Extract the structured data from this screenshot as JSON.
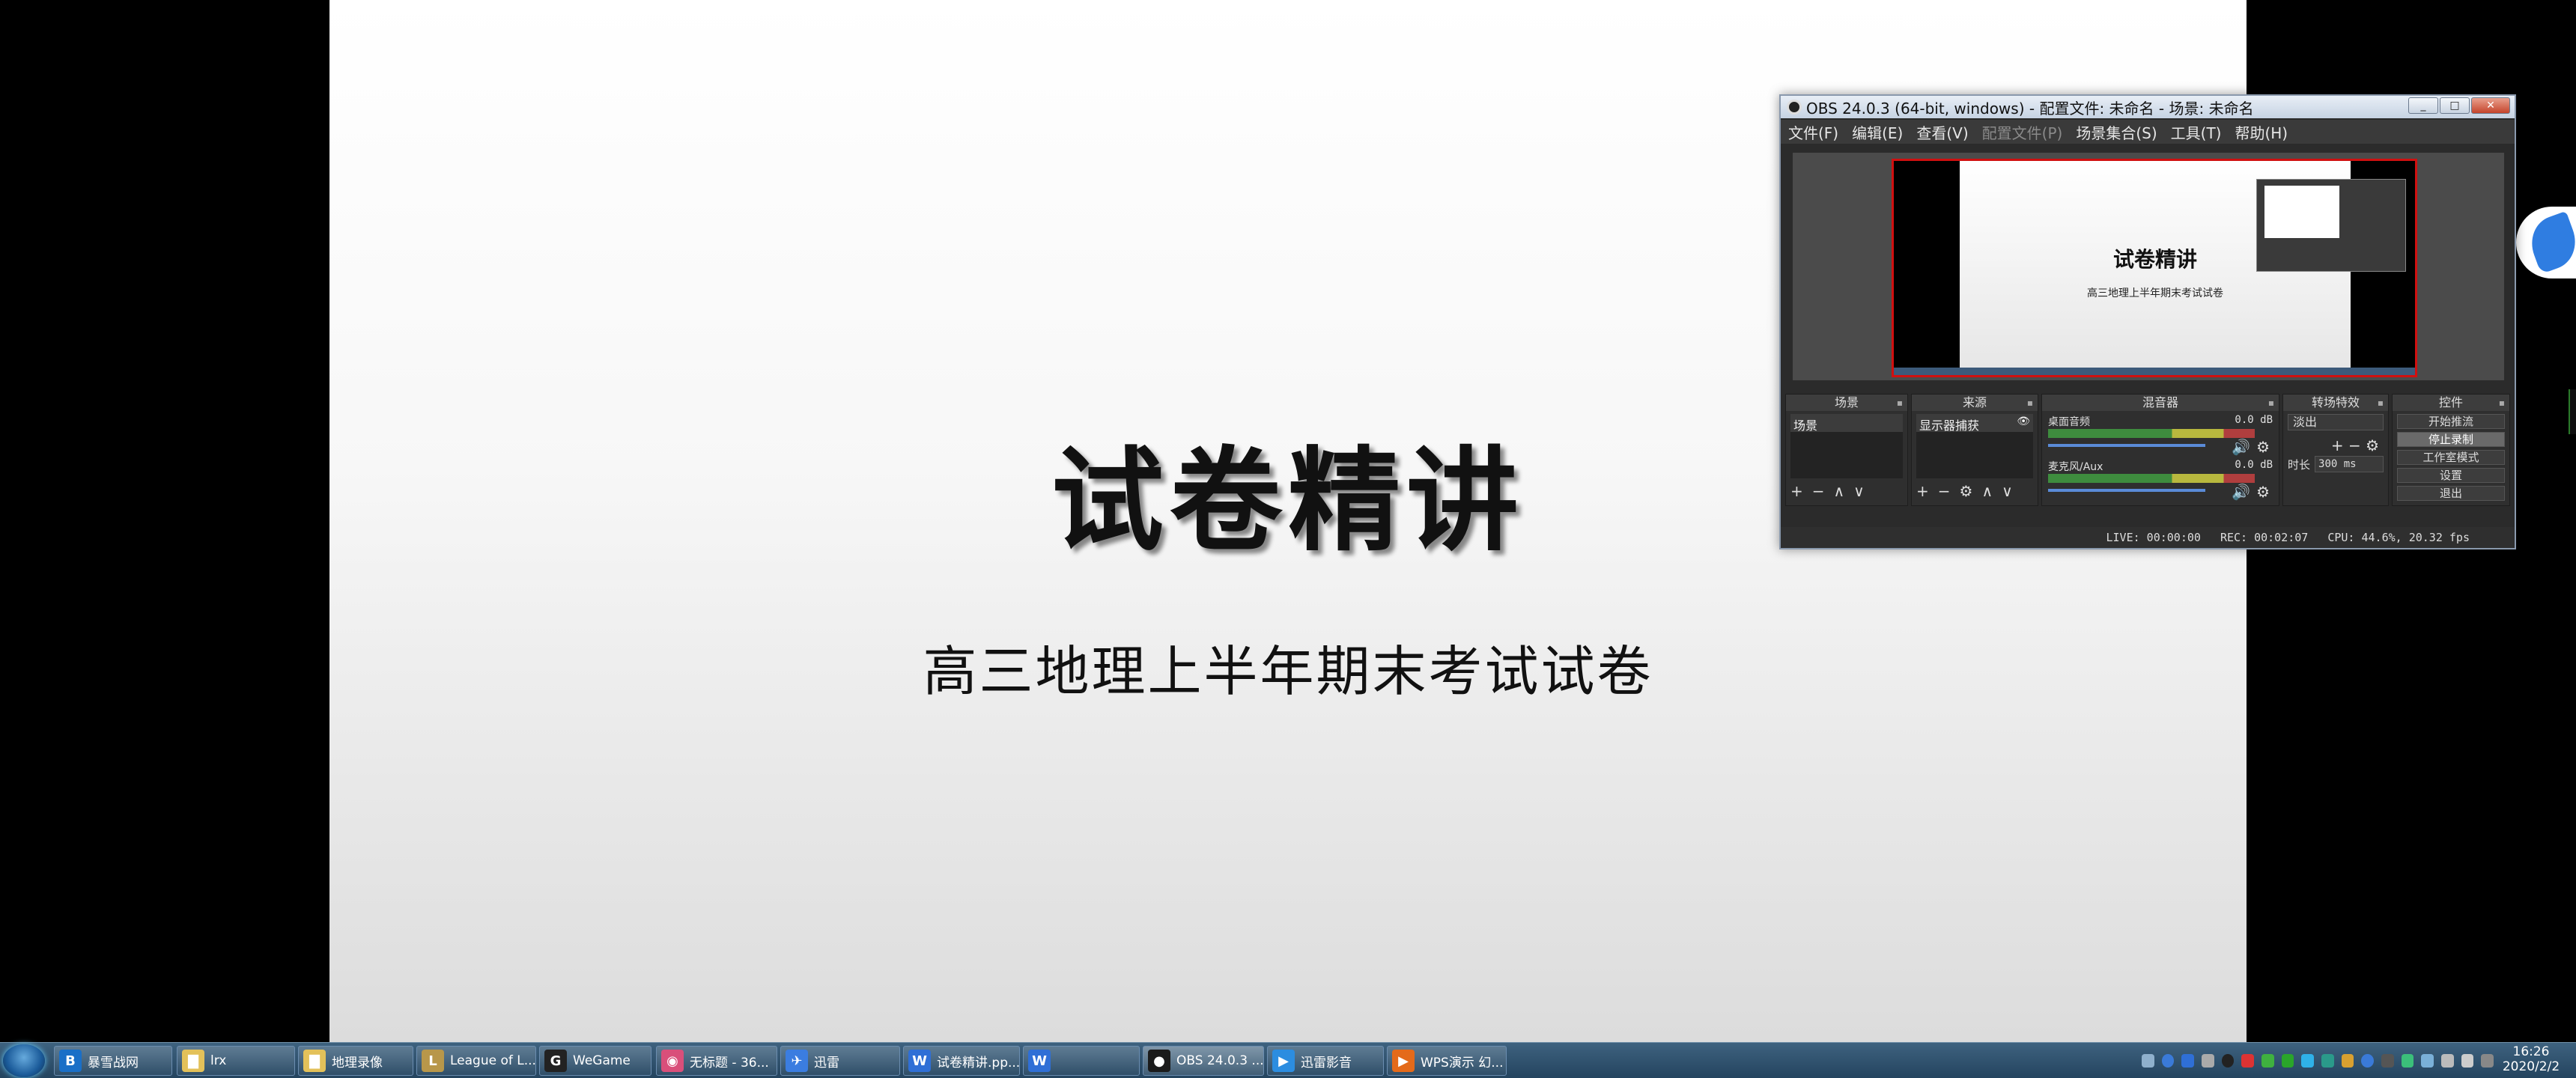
{
  "slide": {
    "title": "试卷精讲",
    "subtitle": "高三地理上半年期末考试试卷"
  },
  "obs": {
    "window_title": "OBS 24.0.3 (64-bit, windows) - 配置文件: 未命名 - 场景: 未命名",
    "window_controls": [
      "_",
      "□",
      "✕"
    ],
    "menu": [
      {
        "label": "文件(F)",
        "enabled": true
      },
      {
        "label": "编辑(E)",
        "enabled": true
      },
      {
        "label": "查看(V)",
        "enabled": true
      },
      {
        "label": "配置文件(P)",
        "enabled": false
      },
      {
        "label": "场景集合(S)",
        "enabled": true
      },
      {
        "label": "工具(T)",
        "enabled": true
      },
      {
        "label": "帮助(H)",
        "enabled": true
      }
    ],
    "preview": {
      "title": "试卷精讲",
      "subtitle": "高三地理上半年期末考试试卷"
    },
    "panels": {
      "scenes": {
        "title": "场景",
        "items": [
          "场景"
        ],
        "footer": [
          "+",
          "−",
          "∧",
          "∨"
        ]
      },
      "sources": {
        "title": "来源",
        "items": [
          "显示器捕获"
        ],
        "footer": [
          "+",
          "−",
          "⚙",
          "∧",
          "∨"
        ]
      },
      "mixer": {
        "title": "混音器",
        "tracks": [
          {
            "name": "桌面音频",
            "db": "0.0 dB"
          },
          {
            "name": "麦克风/Aux",
            "db": "0.0 dB"
          }
        ]
      },
      "transitions": {
        "title": "转场特效",
        "selected": "淡出",
        "duration_label": "时长",
        "duration_value": "300 ms"
      },
      "controls": {
        "title": "控件",
        "buttons": [
          "开始推流",
          "停止录制",
          "工作室模式",
          "设置",
          "退出"
        ]
      }
    },
    "status": {
      "live": "LIVE: 00:00:00",
      "rec": "REC: 00:02:07",
      "cpu": "CPU: 44.6%, 20.32 fps"
    }
  },
  "taskbar": {
    "items": [
      {
        "label": "暴雪战网",
        "icon": "battlenet-icon",
        "color": "#1a6fc7",
        "glyph": "B"
      },
      {
        "label": "lrx",
        "icon": "folder-icon",
        "color": "#e3c15a",
        "glyph": "▇"
      },
      {
        "label": "地理录像",
        "icon": "folder-icon",
        "color": "#e3c15a",
        "glyph": "▇"
      },
      {
        "label": "League of L...",
        "icon": "league-icon",
        "color": "#b8974a",
        "glyph": "L"
      },
      {
        "label": "WeGame",
        "icon": "wegame-icon",
        "color": "#222222",
        "glyph": "G"
      },
      {
        "label": "无标题 - 36...",
        "icon": "browser-icon",
        "color": "#d94f7a",
        "glyph": "◉"
      },
      {
        "label": "迅雷",
        "icon": "xunlei-icon",
        "color": "#3b7de0",
        "glyph": "✈"
      },
      {
        "label": "试卷精讲.pp...",
        "icon": "wps-presentation-icon",
        "color": "#2f6fd6",
        "glyph": "W"
      },
      {
        "label": "",
        "icon": "wps-icon",
        "color": "#2f6fd6",
        "glyph": "W"
      },
      {
        "label": "OBS 24.0.3 ...",
        "icon": "obs-icon",
        "color": "#1b1b1b",
        "glyph": "●"
      },
      {
        "label": "迅雷影音",
        "icon": "xunlei-player-icon",
        "color": "#2c8de0",
        "glyph": "▶"
      },
      {
        "label": "WPS演示 幻...",
        "icon": "wps-slideshow-icon",
        "color": "#e46a1a",
        "glyph": "▶"
      }
    ],
    "clock_time": "16:26",
    "clock_date": "2020/2/2"
  }
}
